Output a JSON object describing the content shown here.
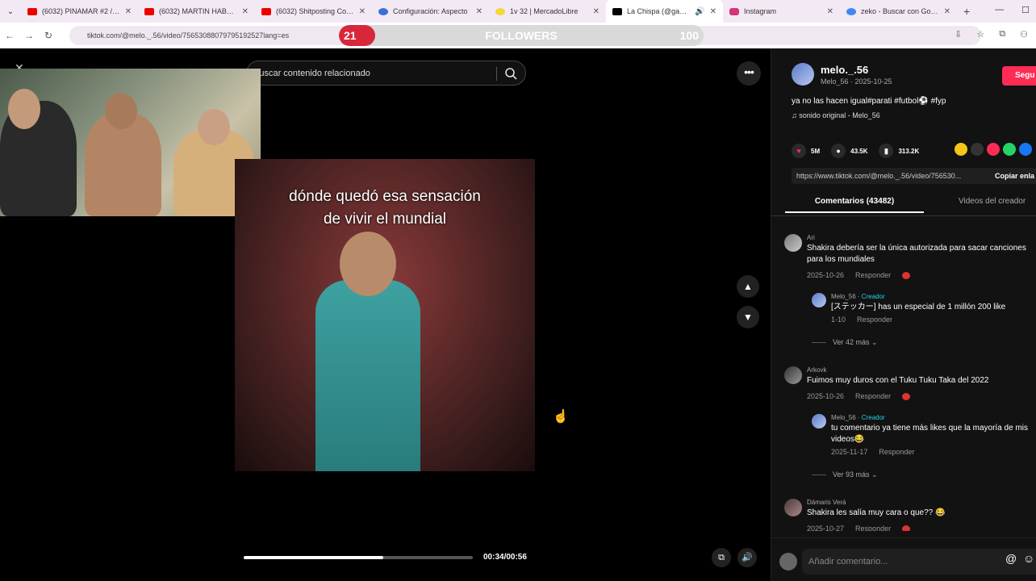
{
  "browser": {
    "tabs": [
      {
        "title": "(6032) PINAMAR #2 // DI"
      },
      {
        "title": "(6032) MARTIN HABLA D"
      },
      {
        "title": "(6032) Shitposting Comp"
      },
      {
        "title": "Configuración: Aspecto"
      },
      {
        "title": "1v 32 | MercadoLibre"
      },
      {
        "title": "La Chispa (@gabip..."
      },
      {
        "title": "Instagram"
      },
      {
        "title": "zeko - Buscar con Google"
      }
    ],
    "url": "tiktok.com/@melo._.56/video/75653088079795192527lang=es"
  },
  "followers_overlay": {
    "current": "21",
    "label": "FOLLOWERS",
    "goal": "100",
    "progress": 0.21
  },
  "video": {
    "search_placeholder": "Buscar contenido relacionado",
    "caption_line1": "dónde quedó esa sensación",
    "caption_line2": "de vivir el mundial",
    "time": "00:34/00:56",
    "progress": 0.61
  },
  "panel": {
    "author_handle": "melo._.56",
    "author_sub": "Melo_56 · 2025-10-25",
    "follow_label": "Segu",
    "description": "ya no las hacen igual#parati #futbol⚽ #fyp",
    "sound": "♫  sonido original - Melo_56",
    "likes": "5M",
    "comments_count": "43.5K",
    "saves": "313.2K",
    "link": "https://www.tiktok.com/@melo._.56/video/756530...",
    "copy_label": "Copiar enla",
    "tab_comments": "Comentarios (43482)",
    "tab_videos": "Videos del creador",
    "comment_placeholder": "Añadir comentario...",
    "comments": [
      {
        "user": "Ari",
        "text": "Shakira debería ser la única autorizada para sacar canciones para los mundiales",
        "date": "2025-10-26",
        "reply": "Responder"
      },
      {
        "user": "Melo_56",
        "creator": " · Creador",
        "text": "[ステッカー] has un especial de 1 millón 200 like",
        "date": "1-10",
        "reply": "Responder"
      },
      {
        "user": "Arkovk",
        "text": "Fuimos muy duros con el Tuku Tuku Taka del 2022",
        "date": "2025-10-26",
        "reply": "Responder"
      },
      {
        "user": "Melo_56",
        "creator": " · Creador",
        "text": "tu comentario ya tiene más likes que la mayoría de mis videos😂",
        "date": "2025-11-17",
        "reply": "Responder"
      },
      {
        "user": "Dámaris Verá",
        "text": "Shakira les salía muy cara o que?? 😂",
        "date": "2025-10-27",
        "reply": "Responder"
      }
    ],
    "more_replies_1": "Ver 42 más ⌄",
    "more_replies_2": "Ver 93 más ⌄"
  }
}
